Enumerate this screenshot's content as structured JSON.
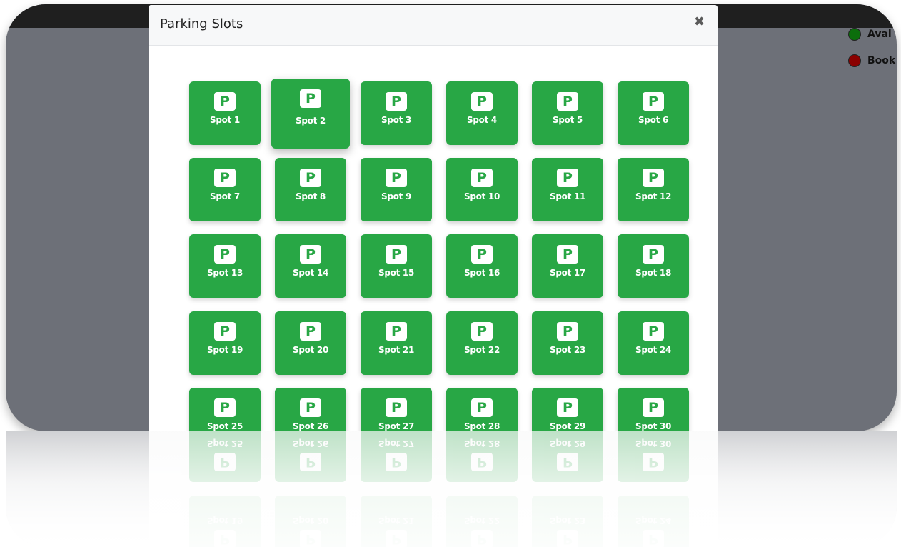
{
  "modal": {
    "title": "Parking Slots",
    "close_glyph": "✖"
  },
  "legend": {
    "items": [
      {
        "label": "Avai",
        "color": "#0c6e0c"
      },
      {
        "label": "Book",
        "color": "#8b0000"
      }
    ]
  },
  "colors": {
    "spot_available": "#28a745",
    "overlay": "#6d7078",
    "topbar": "#1f1f1f"
  },
  "spot_icon": {
    "glyph": "P",
    "name": "parking-icon"
  },
  "spots": [
    "Spot 1",
    "Spot 2",
    "Spot 3",
    "Spot 4",
    "Spot 5",
    "Spot 6",
    "Spot 7",
    "Spot 8",
    "Spot 9",
    "Spot 10",
    "Spot 11",
    "Spot 12",
    "Spot 13",
    "Spot 14",
    "Spot 15",
    "Spot 16",
    "Spot 17",
    "Spot 18",
    "Spot 19",
    "Spot 20",
    "Spot 21",
    "Spot 22",
    "Spot 23",
    "Spot 24",
    "Spot 25",
    "Spot 26",
    "Spot 27",
    "Spot 28",
    "Spot 29",
    "Spot 30"
  ],
  "hovered_spot": "Spot 2"
}
